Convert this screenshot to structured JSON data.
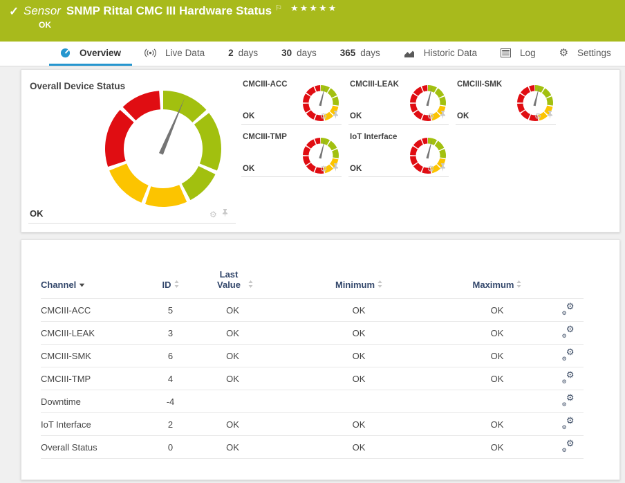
{
  "header": {
    "kind_label": "Sensor",
    "title": "SNMP Rittal CMC III Hardware Status",
    "status": "OK",
    "stars": "★★★★★",
    "bg_color": "#a8ba1c"
  },
  "tabs": [
    {
      "id": "overview",
      "icon": "gauge-icon",
      "prefix": "",
      "label": "Overview",
      "active": true
    },
    {
      "id": "live-data",
      "icon": "broadcast-icon",
      "prefix": "",
      "label": "Live Data",
      "active": false
    },
    {
      "id": "2-days",
      "icon": "",
      "prefix": "2",
      "label": "days",
      "active": false
    },
    {
      "id": "30-days",
      "icon": "",
      "prefix": "30",
      "label": "days",
      "active": false
    },
    {
      "id": "365-days",
      "icon": "",
      "prefix": "365",
      "label": "days",
      "active": false
    },
    {
      "id": "historic-data",
      "icon": "chart-icon",
      "prefix": "",
      "label": "Historic Data",
      "active": false
    },
    {
      "id": "log",
      "icon": "log-icon",
      "prefix": "",
      "label": "Log",
      "active": false
    },
    {
      "id": "settings",
      "icon": "gear-icon",
      "prefix": "",
      "label": "Settings",
      "active": false
    }
  ],
  "overview": {
    "overall_gauge": {
      "title": "Overall Device Status",
      "status": "OK"
    },
    "channel_gauges": [
      {
        "name": "CMCIII-ACC",
        "status": "OK"
      },
      {
        "name": "CMCIII-LEAK",
        "status": "OK"
      },
      {
        "name": "CMCIII-SMK",
        "status": "OK"
      },
      {
        "name": "CMCIII-TMP",
        "status": "OK"
      },
      {
        "name": "IoT Interface",
        "status": "OK"
      }
    ]
  },
  "chart_data": {
    "type": "gauge",
    "title": "Overall Device Status",
    "current_status": "OK",
    "colors": {
      "green": "#a2c00f",
      "yellow": "#fcc400",
      "red": "#e00d12",
      "needle": "#757575"
    },
    "big_gauge": {
      "needle_angle_deg": 23,
      "segments": [
        {
          "from": 0,
          "to": 48,
          "color": "green"
        },
        {
          "from": 52,
          "to": 112,
          "color": "green"
        },
        {
          "from": 116,
          "to": 152,
          "color": "green"
        },
        {
          "from": 156,
          "to": 198,
          "color": "yellow"
        },
        {
          "from": 202,
          "to": 248,
          "color": "yellow"
        },
        {
          "from": 252,
          "to": 312,
          "color": "red"
        },
        {
          "from": 316,
          "to": 356,
          "color": "red"
        }
      ]
    },
    "small_gauge": {
      "needle_angle_deg": 14,
      "segments": [
        {
          "from": 0,
          "to": 30,
          "color": "green"
        },
        {
          "from": 34,
          "to": 64,
          "color": "green"
        },
        {
          "from": 68,
          "to": 98,
          "color": "green"
        },
        {
          "from": 102,
          "to": 132,
          "color": "yellow"
        },
        {
          "from": 136,
          "to": 166,
          "color": "yellow"
        },
        {
          "from": 170,
          "to": 200,
          "color": "red"
        },
        {
          "from": 204,
          "to": 234,
          "color": "red"
        },
        {
          "from": 238,
          "to": 268,
          "color": "red"
        },
        {
          "from": 272,
          "to": 302,
          "color": "red"
        },
        {
          "from": 306,
          "to": 336,
          "color": "red"
        },
        {
          "from": 340,
          "to": 358,
          "color": "red"
        }
      ]
    }
  },
  "table": {
    "columns": [
      {
        "label": "Channel",
        "sort": "sort-desc"
      },
      {
        "label": "ID",
        "sort": "sort"
      },
      {
        "label": "Last Value",
        "sort": "sort"
      },
      {
        "label": "Minimum",
        "sort": "sort"
      },
      {
        "label": "Maximum",
        "sort": "sort"
      },
      {
        "label": "",
        "sort": ""
      }
    ],
    "rows": [
      {
        "channel": "CMCIII-ACC",
        "id": "5",
        "last_value": "OK",
        "minimum": "OK",
        "maximum": "OK"
      },
      {
        "channel": "CMCIII-LEAK",
        "id": "3",
        "last_value": "OK",
        "minimum": "OK",
        "maximum": "OK"
      },
      {
        "channel": "CMCIII-SMK",
        "id": "6",
        "last_value": "OK",
        "minimum": "OK",
        "maximum": "OK"
      },
      {
        "channel": "CMCIII-TMP",
        "id": "4",
        "last_value": "OK",
        "minimum": "OK",
        "maximum": "OK"
      },
      {
        "channel": "Downtime",
        "id": "-4",
        "last_value": "",
        "minimum": "",
        "maximum": ""
      },
      {
        "channel": "IoT Interface",
        "id": "2",
        "last_value": "OK",
        "minimum": "OK",
        "maximum": "OK"
      },
      {
        "channel": "Overall Status",
        "id": "0",
        "last_value": "OK",
        "minimum": "OK",
        "maximum": "OK"
      }
    ]
  }
}
